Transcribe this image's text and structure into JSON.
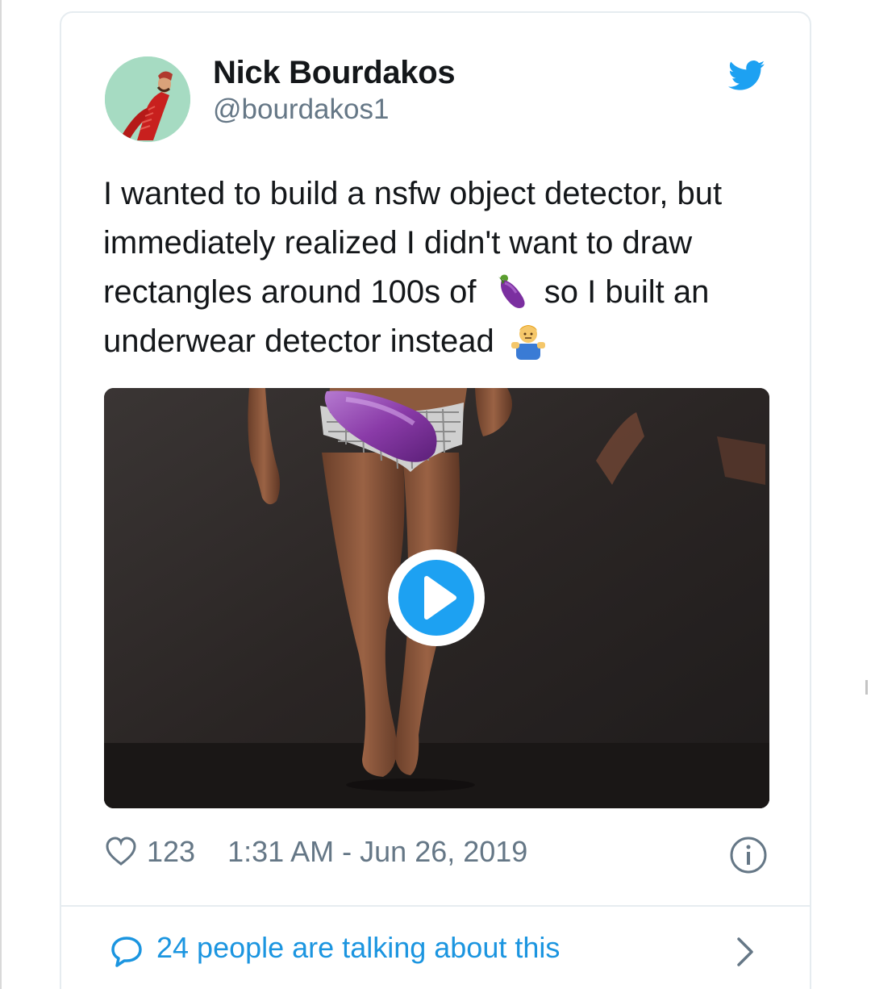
{
  "tweet": {
    "author_name": "Nick Bourdakos",
    "author_handle": "@bourdakos1",
    "text_part1": "I wanted to build a nsfw object detector, but immediately realized I didn't want to draw rectangles around 100s of",
    "emoji_1": "eggplant-emoji",
    "text_part2": "so I built an underwear detector instead",
    "emoji_2": "person-shrugging-emoji",
    "likes": "123",
    "timestamp": "1:31 AM - Jun 26, 2019",
    "conversation_label": "24 people are talking about this"
  },
  "colors": {
    "twitter_blue": "#1da1f2",
    "link_blue": "#1b95e0",
    "text_dark": "#14171a",
    "text_gray": "#657786",
    "border": "#e6ecf0"
  }
}
